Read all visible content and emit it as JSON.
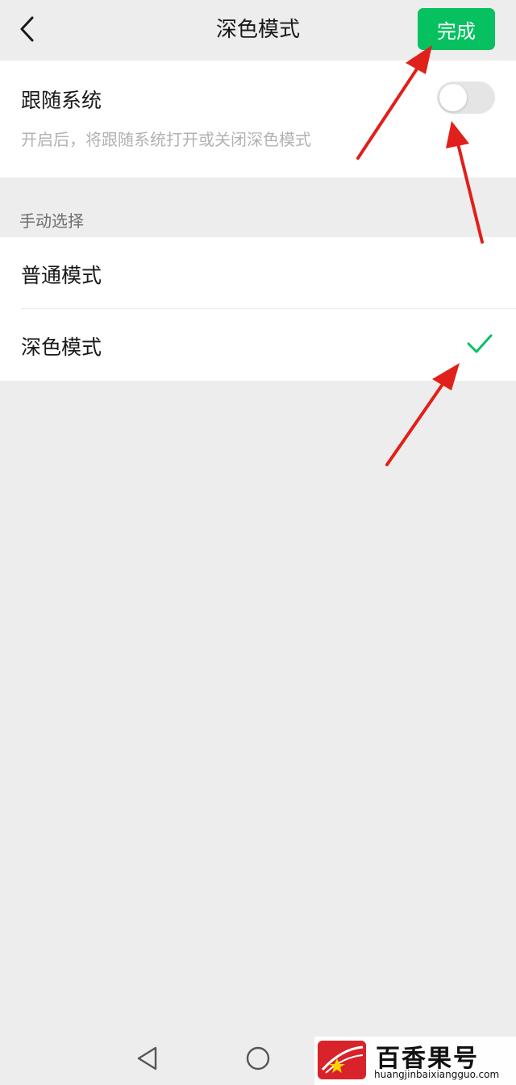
{
  "header": {
    "title": "深色模式",
    "done_label": "完成"
  },
  "follow_system": {
    "title": "跟随系统",
    "description": "开启后，将跟随系统打开或关闭深色模式",
    "enabled": false
  },
  "manual": {
    "section_label": "手动选择",
    "options": [
      {
        "label": "普通模式",
        "selected": false
      },
      {
        "label": "深色模式",
        "selected": true
      }
    ]
  },
  "watermark": {
    "title": "百香果号",
    "url": "huangjinbaixiangguo.com"
  },
  "colors": {
    "accent": "#07c160",
    "annotation_arrow": "#e0201b"
  },
  "icons": {
    "back": "chevron-left-icon",
    "check": "checkmark-icon",
    "nav_back": "triangle-back-icon",
    "nav_home": "circle-home-icon"
  }
}
